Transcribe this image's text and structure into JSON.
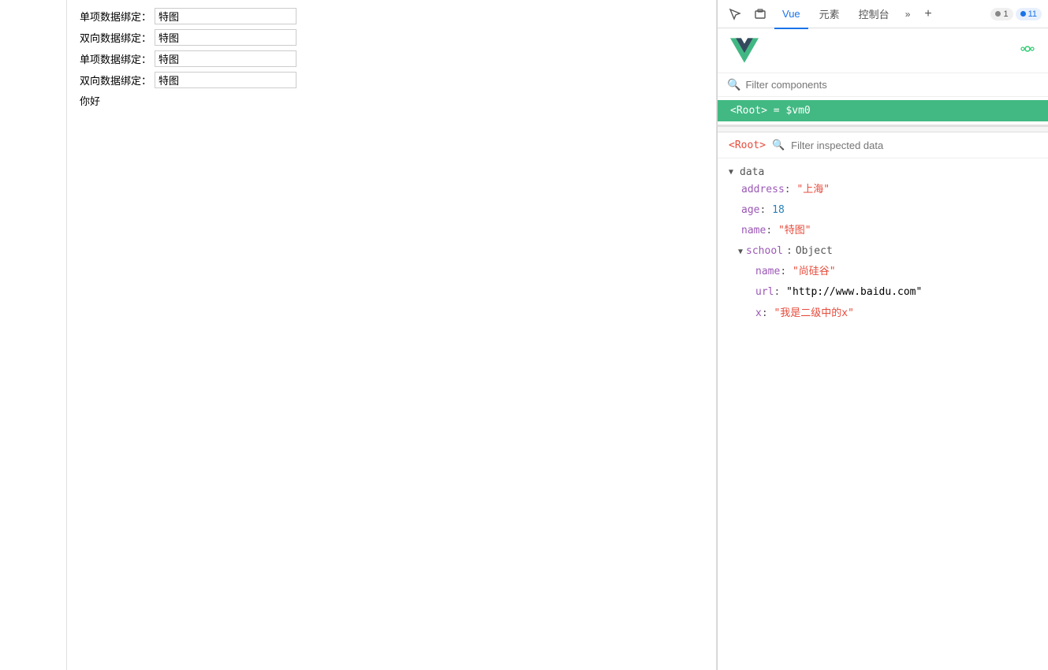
{
  "toolbar": {
    "tabs": [
      {
        "id": "elements",
        "label": "元素",
        "active": false
      },
      {
        "id": "vue",
        "label": "Vue",
        "active": true
      },
      {
        "id": "console",
        "label": "控制台",
        "active": false
      }
    ],
    "more_label": "»",
    "add_label": "+",
    "badge_gray_count": "1",
    "badge_blue_count": "11"
  },
  "vue_panel": {
    "filter_placeholder": "Filter components",
    "root_component": "<Root> = $vm0"
  },
  "inspect_panel": {
    "root_tag_open": "<Root>",
    "filter_placeholder": "Filter inspected data",
    "data_section": "data",
    "fields": [
      {
        "key": "address",
        "colon": ":",
        "value": "\"上海\"",
        "type": "string"
      },
      {
        "key": "age",
        "colon": ":",
        "value": "18",
        "type": "number"
      },
      {
        "key": "name",
        "colon": ":",
        "value": "\"特图\"",
        "type": "string"
      }
    ],
    "school_key": "school",
    "school_colon": ":",
    "school_value": "Object",
    "school_fields": [
      {
        "key": "name",
        "colon": ":",
        "value": "\"尚硅谷\"",
        "type": "string"
      },
      {
        "key": "url",
        "colon": ":",
        "value": "\"http://www.baidu.com\"",
        "type": "url"
      },
      {
        "key": "x",
        "colon": ":",
        "value": "\"我是二级中的x\"",
        "type": "string"
      }
    ]
  },
  "main_content": {
    "rows": [
      {
        "label": "单项数据绑定：",
        "value": "特图"
      },
      {
        "label": "双向数据绑定：",
        "value": "特图"
      },
      {
        "label": "单项数据绑定：",
        "value": "特图"
      },
      {
        "label": "双向数据绑定：",
        "value": "特图"
      }
    ],
    "greeting": "你好"
  }
}
